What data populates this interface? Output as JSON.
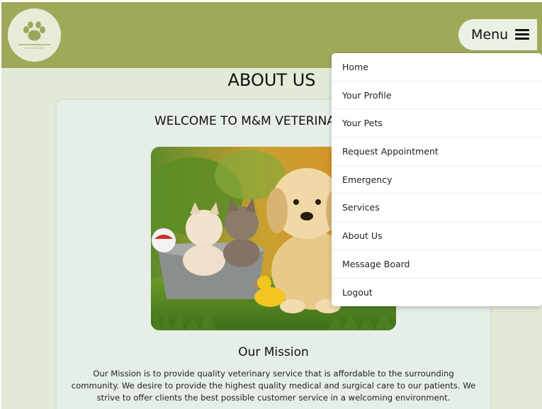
{
  "header": {
    "menu_label": "Menu"
  },
  "page": {
    "title": "ABOUT US"
  },
  "card": {
    "welcome": "WELCOME TO M&M VETERINARY CLINIC",
    "mission_title": "Our Mission",
    "mission_text": "Our Mission is to provide quality veterinary service that is affordable to the surrounding community. We desire to provide the highest quality medical and surgical care to our patients. We strive to offer clients the best possible customer service in a welcoming environment."
  },
  "menu": {
    "items": [
      "Home",
      "Your Profile",
      "Your Pets",
      "Request Appointment",
      "Emergency",
      "Services",
      "About Us",
      "Message Board",
      "Logout"
    ]
  },
  "icons": {
    "logo": "paw-icon",
    "menu": "hamburger-icon"
  },
  "colors": {
    "header": "#a0a85a",
    "background": "#e2ebd8",
    "card": "#e6efe7",
    "menu_button": "#e9f1e5"
  }
}
